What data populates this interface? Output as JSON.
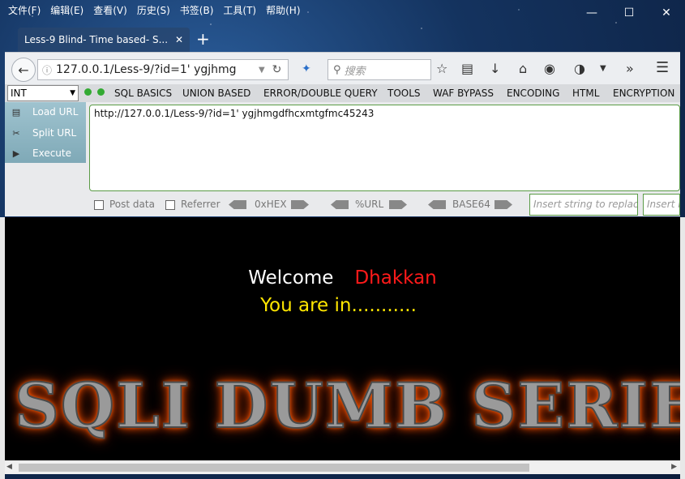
{
  "menubar": {
    "items": [
      "文件(F)",
      "编辑(E)",
      "查看(V)",
      "历史(S)",
      "书签(B)",
      "工具(T)",
      "帮助(H)"
    ]
  },
  "window_controls": {
    "minimize": "—",
    "maximize": "☐",
    "close": "✕"
  },
  "tab": {
    "title": "Less-9 Blind- Time based- S...",
    "close": "✕",
    "new_tab": "+"
  },
  "navbar": {
    "url": "127.0.0.1/Less-9/?id=1' ygjhmg",
    "search_placeholder": "搜索"
  },
  "hackbar": {
    "select_value": "INT",
    "menus": [
      "SQL BASICS",
      "UNION BASED",
      "ERROR/DOUBLE QUERY",
      "TOOLS",
      "WAF BYPASS",
      "ENCODING",
      "HTML",
      "ENCRYPTION"
    ],
    "load_url": "Load URL",
    "split_url": "Split URL",
    "execute": "Execute",
    "url_value": "http://127.0.0.1/Less-9/?id=1' ygjhmgdfhcxmtgfmc45243",
    "post_data": "Post data",
    "referrer": "Referrer",
    "hex": "0xHEX",
    "urlenc": "%URL",
    "base64": "BASE64",
    "insert_replace": "Insert string to replace",
    "insert_other": "Insert r"
  },
  "page": {
    "welcome": "Welcome",
    "name": "Dhakkan",
    "status": "You are in...........",
    "banner": "SQLI DUMB SERIES"
  },
  "colors": {
    "welcome": "#ffffff",
    "name": "#ff1a1a",
    "status": "#ffe600",
    "banner_glow": "#ff5a00"
  }
}
